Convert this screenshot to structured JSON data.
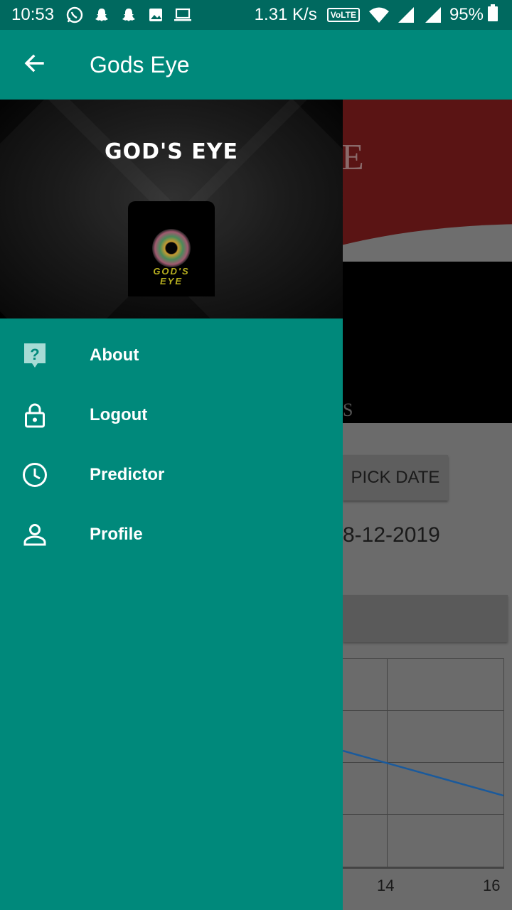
{
  "status_bar": {
    "time": "10:53",
    "network_speed": "1.31 K/s",
    "volte": "VoLTE",
    "battery": "95%",
    "icons": [
      "whatsapp-icon",
      "snapchat-icon",
      "snapchat-icon",
      "gallery-icon",
      "laptop-icon",
      "wifi-icon",
      "signal-icon",
      "signal-icon",
      "battery-icon"
    ]
  },
  "app_bar": {
    "title": "Gods Eye",
    "back_icon": "arrow-back-icon"
  },
  "drawer": {
    "header": {
      "brand_title": "GOD'S EYE",
      "logo_text_line1": "GOD'S",
      "logo_text_line2": "EYE"
    },
    "items": [
      {
        "label": "About",
        "icon": "help-icon"
      },
      {
        "label": "Logout",
        "icon": "lock-icon"
      },
      {
        "label": "Predictor",
        "icon": "clock-icon"
      },
      {
        "label": "Profile",
        "icon": "person-icon"
      }
    ]
  },
  "background": {
    "banner_partial_letter": "E",
    "banner_partial_sub": "S",
    "pick_date_label": "PICK DATE",
    "date_partial": "8-12-2019",
    "chart_tick_labels": [
      "14",
      "16"
    ]
  },
  "colors": {
    "primary": "#00897b",
    "primary_dark": "#00695f",
    "chart_line": "#1a5a9c"
  }
}
